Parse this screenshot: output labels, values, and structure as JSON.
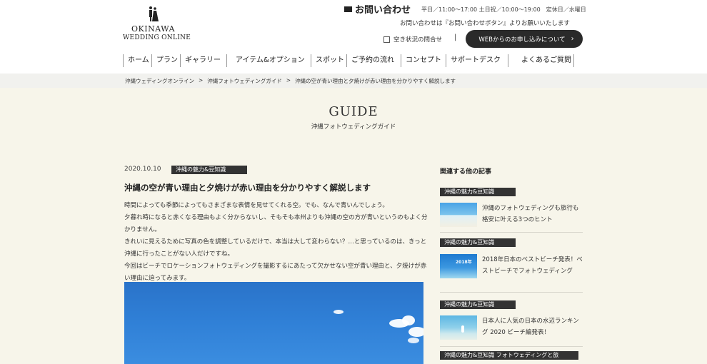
{
  "header": {
    "logo_line1": "OKINAWA",
    "logo_line2": "WEDDING ONLINE",
    "contact_title": "お問い合わせ",
    "hours": "平日／11:00〜17:00 土日祝／10:00〜19:00　定休日／水曜日",
    "contact_note": "お問い合わせは『お問い合わせボタン』よりお願いいたします",
    "availability_link": "空き状況の問合せ",
    "separator": "|",
    "web_button": "WEBからのお申し込みについて",
    "web_button_chevron": "›"
  },
  "nav": {
    "items": [
      "ホーム",
      "プラン",
      "ギャラリー",
      "アイテム&オプション",
      "スポット",
      "ご予約の流れ",
      "コンセプト",
      "サポートデスク",
      "よくあるご質問"
    ]
  },
  "breadcrumb": {
    "items": [
      "沖縄ウェディングオンライン",
      "沖縄フォトウェディングガイド",
      "沖縄の空が青い理由と夕焼けが赤い理由を分かりやすく解説します"
    ],
    "sep": ">"
  },
  "guide": {
    "title": "GUIDE",
    "subtitle": "沖縄フォトウェディングガイド"
  },
  "article": {
    "date": "2020.10.10",
    "category": "沖縄の魅力&豆知識",
    "title": "沖縄の空が青い理由と夕焼けが赤い理由を分かりやすく解説します",
    "paragraphs": [
      "時間によっても季節によってもさまざまな表情を見せてくれる空。でも、なんで青いんでしょう。",
      "夕暮れ時になると赤くなる理由もよく分からないし、そもそも本州よりも沖縄の空の方が青いというのもよく分かりません。",
      "きれいに見えるために写真の色を調整しているだけで、本当は大して変わらない？…と思っているのは、きっと沖縄に行ったことがない人だけですね。",
      "今回はビーチでロケーションフォトウェディングを撮影するにあたって欠かせない空が青い理由と、夕焼けが赤い理由に迫ってみます。"
    ]
  },
  "sidebar": {
    "title": "関連する他の記事",
    "items": [
      {
        "category": "沖縄の魅力&豆知識",
        "text": "沖縄のフォトウェディングも旅行も格安に叶える3つのヒント"
      },
      {
        "category": "沖縄の魅力&豆知識",
        "text": "2018年日本のベストビーチ発表！ベストビーチでフォトウェディング",
        "thumb_text": "2018年"
      },
      {
        "category": "沖縄の魅力&豆知識",
        "text": "日本人に人気の日本の水辺ランキング 2020 ビーチ編発表！"
      },
      {
        "category": "沖縄の魅力&豆知識 フォトウェディングと旅"
      }
    ]
  },
  "colors": {
    "main_bg": "#f7f5ea",
    "badge": "#333333",
    "button": "#2a2a2a",
    "sky": "#2f7fd6"
  }
}
